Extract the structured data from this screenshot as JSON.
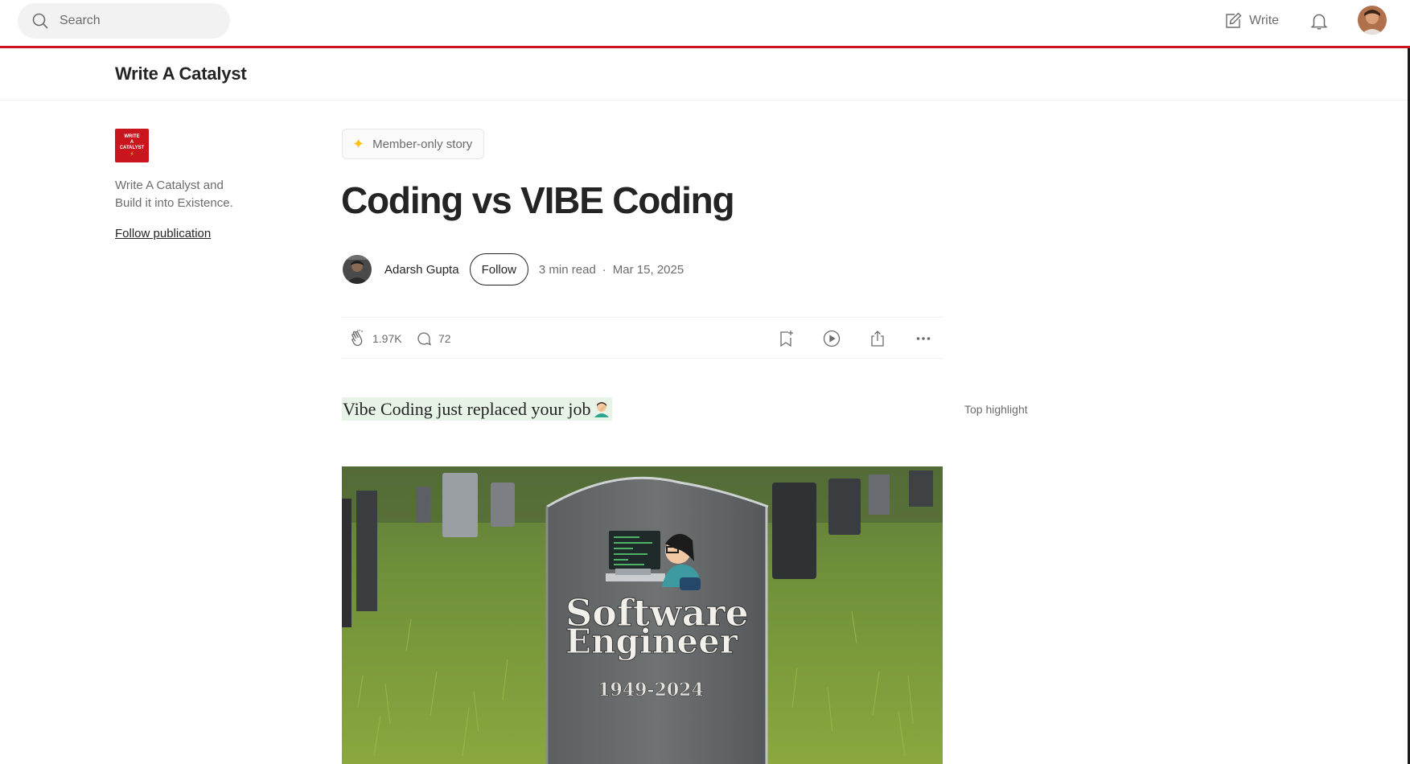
{
  "topbar": {
    "search_placeholder": "Search",
    "write_label": "Write",
    "icons": [
      "search-icon",
      "write-icon",
      "bell-icon",
      "avatar"
    ]
  },
  "publication": {
    "name": "Write A Catalyst",
    "logo_text": [
      "WRITE",
      "A",
      "CATALYST"
    ],
    "description": "Write A Catalyst and Build it into Existence.",
    "follow_label": "Follow publication"
  },
  "article": {
    "member_label": "Member-only story",
    "title": "Coding vs VIBE Coding",
    "author": "Adarsh Gupta",
    "follow_label": "Follow",
    "read_time": "3 min read",
    "separator": "·",
    "date": "Mar 15, 2025",
    "claps": "1.97K",
    "responses": "72",
    "lede": "Vibe Coding just replaced your job",
    "top_highlight_label": "Top highlight"
  },
  "hero_image": {
    "line1": "Software",
    "line2": "Engineer",
    "years": "1949-2024"
  },
  "colors": {
    "brand_red": "#c9151e",
    "highlight_green": "#e8f3e8",
    "member_star": "#ffc017",
    "text_primary": "#242424",
    "text_secondary": "#6b6b6b"
  }
}
